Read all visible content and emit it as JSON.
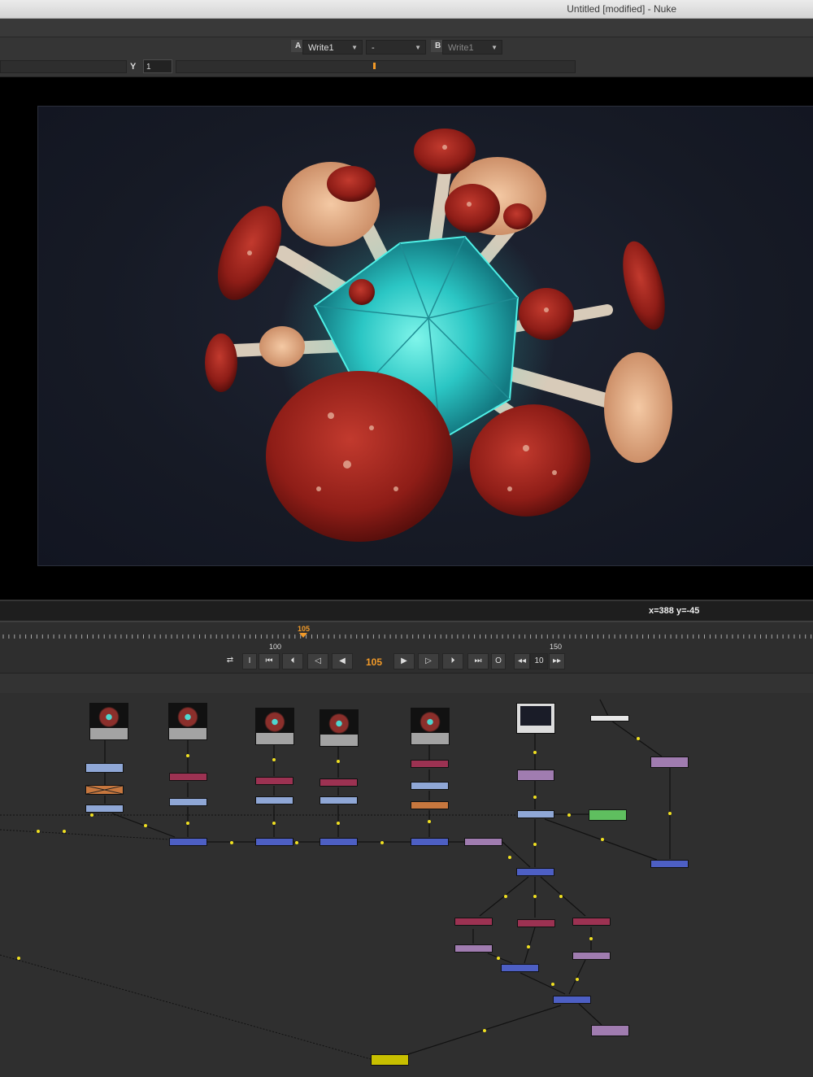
{
  "window": {
    "title": "Untitled [modified] - Nuke"
  },
  "viewer_toolbar": {
    "input_a_label": "A",
    "input_a_value": "Write1",
    "operation_value": "-",
    "input_b_label": "B",
    "input_b_value": "Write1",
    "y_label": "Y",
    "y_value": "1"
  },
  "viewer_info": {
    "coords": "x=388 y=-45"
  },
  "timeline": {
    "current_frame_marker": "105",
    "tick_label_100": "100",
    "tick_label_150": "150",
    "current_frame": "105",
    "increment": "10"
  },
  "icons": {
    "loop": "loop-mode-icon",
    "in_point": "in-point-icon",
    "first_frame": "first-frame-icon",
    "prev_keyframe": "previous-keyframe-icon",
    "prev_frame": "previous-frame-icon",
    "play_backward": "play-backward-icon",
    "play_forward": "play-forward-icon",
    "next_frame": "next-frame-icon",
    "next_keyframe": "next-keyframe-icon",
    "last_frame": "last-frame-icon",
    "out_point": "out-point-icon",
    "step_back": "step-back-icon",
    "step_forward": "step-forward-icon"
  },
  "colors": {
    "frame_accent": "#f29a28",
    "node_blue": "#4d5fc4",
    "node_light_blue": "#8fa7d6",
    "node_maroon": "#9c3252",
    "node_purple": "#a07cb0",
    "node_orange": "#c7773e",
    "node_green": "#5fbf5f",
    "node_yellow": "#c8c000"
  }
}
